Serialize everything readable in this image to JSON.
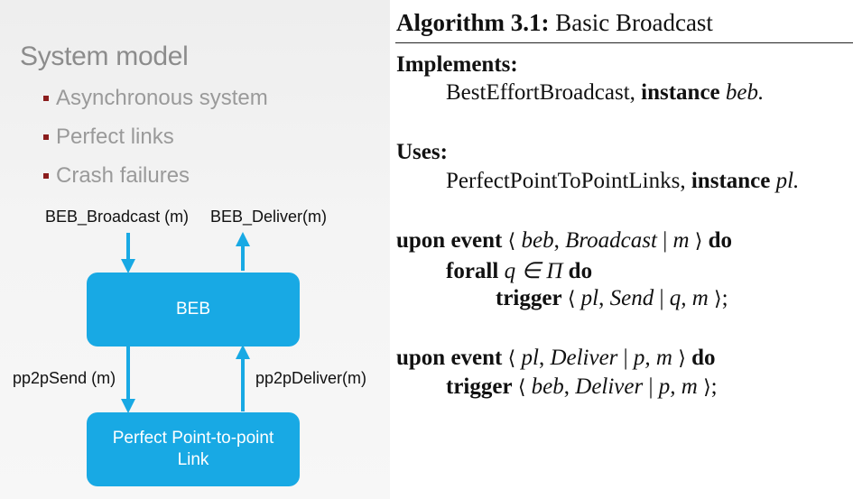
{
  "left": {
    "title": "System model",
    "bullets": [
      "Asynchronous system",
      "Perfect links",
      "Crash failures"
    ],
    "labels": {
      "beb_broadcast": "BEB_Broadcast (m)",
      "beb_deliver": "BEB_Deliver(m)",
      "pp2p_send": "pp2pSend (m)",
      "pp2p_deliver": "pp2pDeliver(m)"
    },
    "boxes": {
      "beb": "BEB",
      "link_line1": "Perfect Point-to-point",
      "link_line2": "Link"
    },
    "colors": {
      "box": "#18a9e4",
      "bullet": "#8b1d1d",
      "title": "#8c8c8c"
    }
  },
  "algorithm": {
    "title_bold": "Algorithm 3.1:",
    "title_rest": " Basic Broadcast",
    "implements_kw": "Implements:",
    "implements_name": "BestEffortBroadcast, ",
    "instance_kw": "instance",
    "implements_inst": "beb.",
    "uses_kw": "Uses:",
    "uses_name": "PerfectPointToPointLinks, ",
    "uses_inst": "pl.",
    "upon_event_kw": "upon event",
    "do_kw": "do",
    "ev1": {
      "inst": "beb",
      "name": "Broadcast",
      "params": "m"
    },
    "forall_kw": "forall",
    "forall_expr": "q ∈ Π",
    "trigger_kw": "trigger",
    "ev1_trigger": {
      "inst": "pl",
      "name": "Send",
      "params": "q, m"
    },
    "ev2": {
      "inst": "pl",
      "name": "Deliver",
      "params": "p, m"
    },
    "ev2_trigger": {
      "inst": "beb",
      "name": "Deliver",
      "params": "p, m"
    },
    "punct": {
      "langle": "⟨",
      "rangle": "⟩",
      "bar": " | ",
      "comma": ", ",
      "semi": ";"
    }
  }
}
